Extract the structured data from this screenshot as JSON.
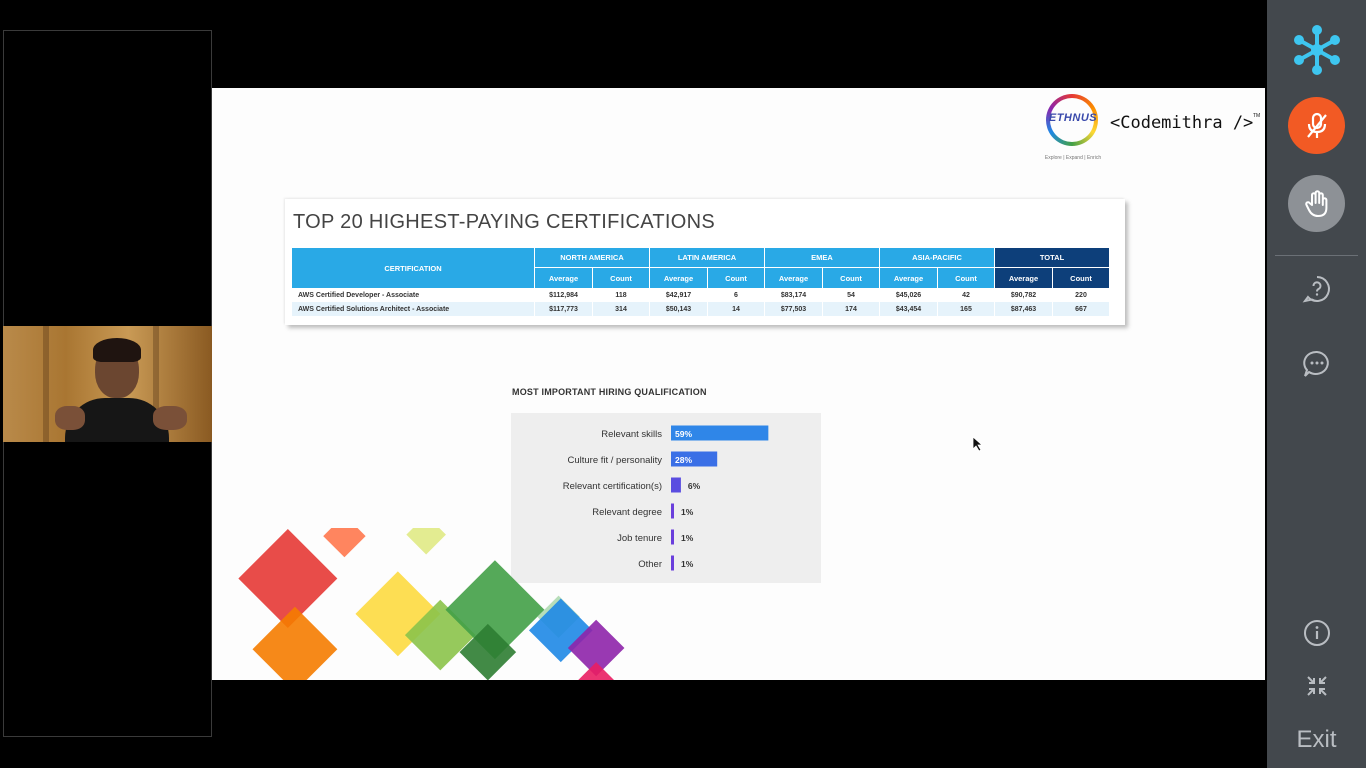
{
  "slide": {
    "logo_word": "ETHNUS",
    "logo_tagline": "Explore | Expand | Enrich",
    "brand": "<Codemithra />",
    "brand_tm": "TM",
    "cert_title": "TOP 20 HIGHEST-PAYING CERTIFICATIONS",
    "table": {
      "cert_header": "CERTIFICATION",
      "regions": [
        "NORTH AMERICA",
        "LATIN AMERICA",
        "EMEA",
        "ASIA-PACIFIC",
        "TOTAL"
      ],
      "sub_headers": [
        "Average",
        "Count"
      ],
      "rows": [
        {
          "name": "AWS Certified Developer - Associate",
          "values": [
            "$112,984",
            "118",
            "$42,917",
            "6",
            "$83,174",
            "54",
            "$45,026",
            "42",
            "$90,782",
            "220"
          ]
        },
        {
          "name": "AWS Certified Solutions Architect - Associate",
          "values": [
            "$117,773",
            "314",
            "$50,143",
            "14",
            "$77,503",
            "174",
            "$43,454",
            "165",
            "$87,463",
            "667"
          ]
        }
      ]
    },
    "hiring_heading": "MOST IMPORTANT HIRING QUALIFICATION"
  },
  "chart_data": {
    "type": "bar",
    "orientation": "horizontal",
    "title": "MOST IMPORTANT HIRING QUALIFICATION",
    "categories": [
      "Relevant skills",
      "Culture fit / personality",
      "Relevant certification(s)",
      "Relevant degree",
      "Job tenure",
      "Other"
    ],
    "values": [
      59,
      28,
      6,
      1,
      1,
      1
    ],
    "value_labels": [
      "59%",
      "28%",
      "6%",
      "1%",
      "1%",
      "1%"
    ],
    "unit": "%",
    "xlim": [
      0,
      100
    ],
    "grid": false,
    "legend": "none",
    "colors": [
      "#2f86e8",
      "#3a6fe6",
      "#5a4de0",
      "#6a3fdc",
      "#6a3fdc",
      "#6a3fdc"
    ]
  },
  "toolbar": {
    "exit_label": "Exit",
    "mic_color": "#f25a24",
    "accent": "#3ec6f0"
  }
}
